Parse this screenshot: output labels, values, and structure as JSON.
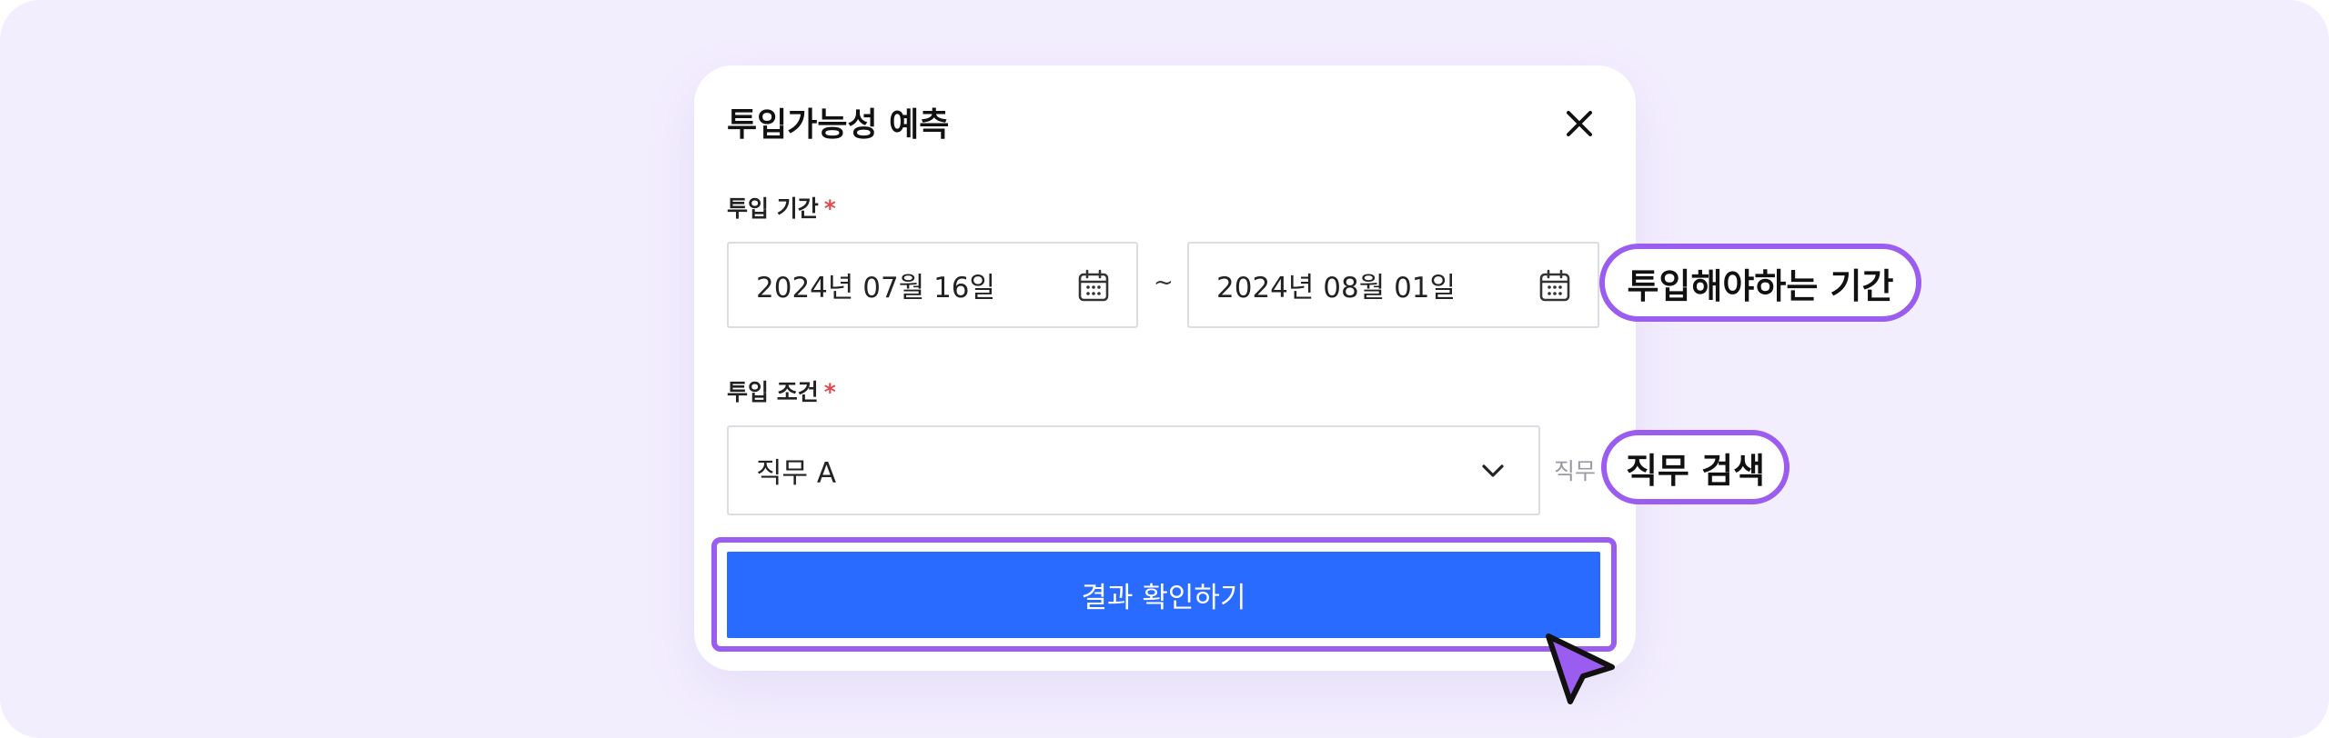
{
  "modal": {
    "title": "투입가능성 예측",
    "period": {
      "label": "투입 기간",
      "required_mark": "*",
      "start": "2024년 07월 16일",
      "separator": "~",
      "end": "2024년 08월 01일"
    },
    "condition": {
      "label": "투입 조건",
      "required_mark": "*",
      "selected": "직무 A",
      "hint": "직무"
    },
    "submit_label": "결과 확인하기"
  },
  "annotations": {
    "period_callout": "투입해야하는 기간",
    "job_callout": "직무 검색"
  },
  "icons": [
    "close-icon",
    "calendar-icon",
    "chevron-down-icon",
    "cursor-arrow-icon"
  ],
  "colors": {
    "background": "#f3eefe",
    "primary_button": "#2a6bff",
    "highlight_outline": "#9b5cf0",
    "required": "#e5484d"
  }
}
